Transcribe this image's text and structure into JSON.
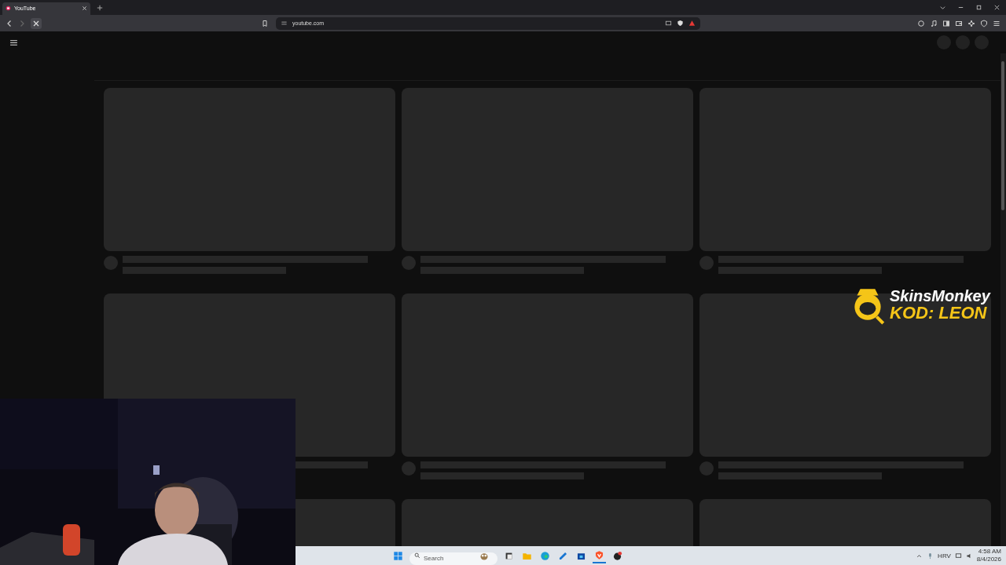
{
  "browser": {
    "tabs": [
      {
        "title": "YouTube",
        "selected": true
      }
    ],
    "address": "youtube.com",
    "loading": true
  },
  "overlay": {
    "brand": "SkinsMonkey",
    "code": "KOD: LEON"
  },
  "taskbar": {
    "search_placeholder": "Search",
    "language": "HRV",
    "time": "4:58 AM",
    "date": "8/4/2026"
  }
}
